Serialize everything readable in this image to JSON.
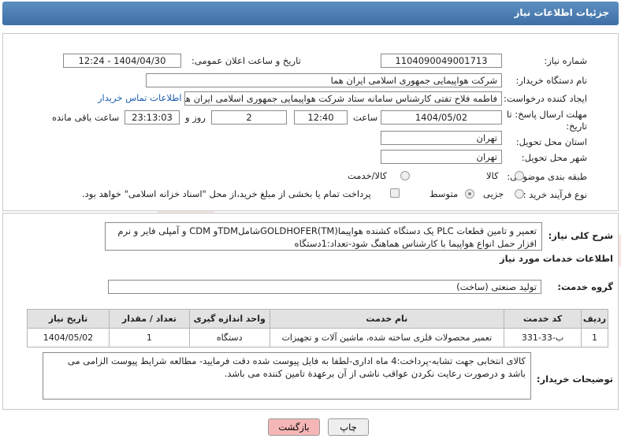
{
  "header": {
    "title": "جزئیات اطلاعات نیاز"
  },
  "fields": {
    "need_number_label": "شماره نیاز:",
    "need_number": "1104090049001713",
    "announce_label": "تاریخ و ساعت اعلان عمومی:",
    "announce_value": "1404/04/30 - 12:24",
    "buyer_org_label": "نام دستگاه خریدار:",
    "buyer_org": "شرکت هواپیمایی جمهوری اسلامی ایران هما",
    "creator_label": "ایجاد کننده درخواست:",
    "creator": "فاطمه فلاح تفتی کارشناس سامانه ستاد شرکت هواپیمایی جمهوری اسلامی ایران هما",
    "contact_link": "اطلاعات تماس خریدار",
    "deadline_label": "مهلت ارسال پاسخ: تا تاریخ:",
    "deadline_date": "1404/05/02",
    "time_label": "ساعت",
    "deadline_time": "12:40",
    "days_label": "روز و",
    "days_value": "2",
    "remaining_time": "23:13:03",
    "remaining_label": "ساعت باقی مانده",
    "province_label": "استان محل تحویل:",
    "province": "تهران",
    "city_label": "شهر محل تحویل:",
    "city": "تهران",
    "category_label": "طبقه بندی موضوعی:",
    "category_options": [
      "کالا",
      "کالا/خدمت"
    ],
    "process_label": "نوع فرآیند خرید :",
    "process_options": [
      "جزیی",
      "متوسط"
    ],
    "payment_note": "پرداخت تمام یا بخشی از مبلغ خرید،از محل \"اسناد خزانه اسلامی\" خواهد بود."
  },
  "description": {
    "label": "شرح کلی نیاز:",
    "text": "تعمیر و تامین قطعات PLC یک دستگاه کشنده هواپیما(GOLDHOFER(TMشاملTDMو CDM و آمپلی فایر و نرم افزار حمل انواع هواپیما با کارشناس هماهنگ شود-تعداد:1دستگاه"
  },
  "services": {
    "section_title": "اطلاعات خدمات مورد نیاز",
    "group_label": "گروه خدمت:",
    "group_value": "تولید صنعتی (ساخت)",
    "columns": [
      "ردیف",
      "کد خدمت",
      "نام خدمت",
      "واحد اندازه گیری",
      "تعداد / مقدار",
      "تاریخ نیاز"
    ],
    "rows": [
      [
        "1",
        "ب-33-331",
        "تعمیر محصولات فلزی ساخته شده، ماشین آلات و تجهیزات",
        "دستگاه",
        "1",
        "1404/05/02"
      ]
    ]
  },
  "buyer_notes": {
    "label": "توضیحات خریدار:",
    "text": "کالای انتخابی جهت تشابه-پرداخت:4 ماه اداری-لطفا به فایل پیوست شده دقت فرمایید- مطالعه شرایط پیوست الزامی می باشد و درصورت رعایت نکردن عواقب ناشی از آن برعهدة تامین کننده می باشد."
  },
  "buttons": {
    "print": "چاپ",
    "back": "بازگشت"
  },
  "watermark": {
    "text": "AriaTender.neT"
  }
}
